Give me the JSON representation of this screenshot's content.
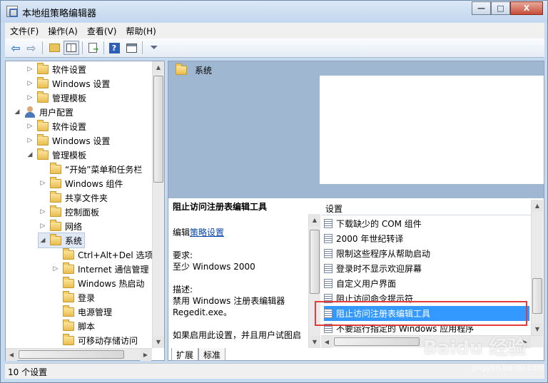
{
  "window": {
    "title": "本地组策略编辑器"
  },
  "window_controls": {
    "minimize": "—",
    "maximize": "□",
    "close": "X"
  },
  "menu": [
    "文件(F)",
    "操作(A)",
    "查看(V)",
    "帮助(H)"
  ],
  "tree": [
    {
      "label": "软件设置",
      "expander": "collapsed",
      "icon": "folder-icon"
    },
    {
      "label": "Windows 设置",
      "expander": "collapsed",
      "icon": "folder-icon"
    },
    {
      "label": "管理模板",
      "expander": "collapsed",
      "icon": "folder-icon"
    },
    {
      "label": "用户配置",
      "expander": "expanded",
      "icon": "user-icon"
    },
    {
      "label": "软件设置",
      "expander": "collapsed",
      "icon": "folder-icon"
    },
    {
      "label": "Windows 设置",
      "expander": "collapsed",
      "icon": "folder-icon"
    },
    {
      "label": "管理模板",
      "expander": "expanded",
      "icon": "folder-icon"
    },
    {
      "label": "“开始”菜单和任务栏",
      "expander": "none",
      "icon": "folder-icon"
    },
    {
      "label": "Windows 组件",
      "expander": "collapsed",
      "icon": "folder-icon"
    },
    {
      "label": "共享文件夹",
      "expander": "none",
      "icon": "folder-icon"
    },
    {
      "label": "控制面板",
      "expander": "collapsed",
      "icon": "folder-icon"
    },
    {
      "label": "网络",
      "expander": "collapsed",
      "icon": "folder-icon"
    },
    {
      "label": "系统",
      "expander": "expanded",
      "icon": "folder-icon",
      "selected": true
    },
    {
      "label": "Ctrl+Alt+Del 选项",
      "expander": "none",
      "icon": "folder-icon"
    },
    {
      "label": "Internet 通信管理",
      "expander": "collapsed",
      "icon": "folder-icon"
    },
    {
      "label": "Windows 热启动",
      "expander": "none",
      "icon": "folder-icon"
    },
    {
      "label": "登录",
      "expander": "none",
      "icon": "folder-icon"
    },
    {
      "label": "电源管理",
      "expander": "none",
      "icon": "folder-icon"
    },
    {
      "label": "脚本",
      "expander": "none",
      "icon": "folder-icon"
    },
    {
      "label": "可移动存储访问",
      "expander": "none",
      "icon": "folder-icon"
    }
  ],
  "right_header": {
    "folder_label": "系统"
  },
  "description": {
    "title": "阻止访问注册表编辑工具",
    "edit_prefix": "编辑",
    "edit_link": "策略设置",
    "requirement_label": "要求:",
    "requirement_value": "至少 Windows 2000",
    "description_label": "描述:",
    "description_line1": "禁用 Windows 注册表编辑器",
    "description_line2": "Regedit.exe。",
    "description_line3": "如果启用此设置，并且用户试图启"
  },
  "settings_list": {
    "header": "设置",
    "rows": [
      {
        "label": "下载缺少的 COM 组件",
        "selected": false
      },
      {
        "label": "2000 年世纪转译",
        "selected": false
      },
      {
        "label": "限制这些程序从帮助启动",
        "selected": false
      },
      {
        "label": "登录时不显示欢迎屏幕",
        "selected": false
      },
      {
        "label": "自定义用户界面",
        "selected": false
      },
      {
        "label": "阻止访问命令提示符",
        "selected": false
      },
      {
        "label": "阻止访问注册表编辑工具",
        "selected": true
      },
      {
        "label": "不要运行指定的 Windows 应用程序",
        "selected": false
      }
    ]
  },
  "tabs": [
    "扩展",
    "标准"
  ],
  "status": {
    "text": "10 个设置"
  },
  "watermark": {
    "brand": "Baidu 经验",
    "url": "jingyan.baidu.com"
  }
}
